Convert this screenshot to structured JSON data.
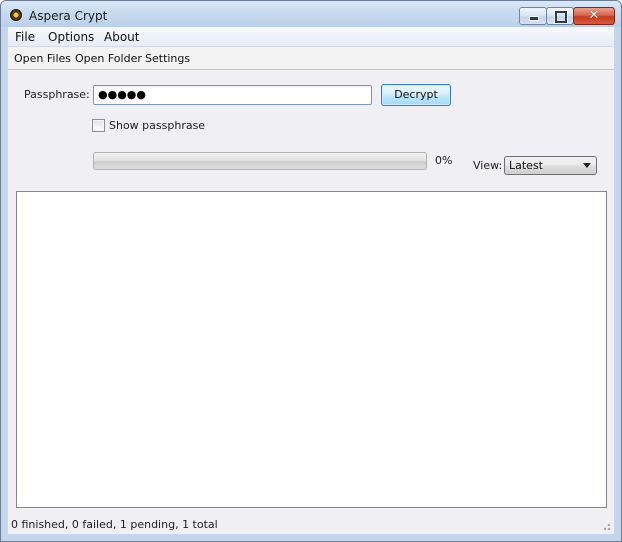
{
  "window": {
    "title": "Aspera Crypt",
    "app_icon": "aspera-crypt-icon",
    "controls": {
      "minimize_icon": "minimize-icon",
      "maximize_icon": "maximize-icon",
      "close_icon": "close-icon",
      "close_glyph": "✕"
    }
  },
  "menu": {
    "items": [
      "File",
      "Options",
      "About"
    ]
  },
  "toolbar": {
    "items": [
      "Open Files",
      "Open Folder",
      "Settings"
    ]
  },
  "form": {
    "passphrase_label": "Passphrase:",
    "passphrase_value": "●●●●●",
    "decrypt_label": "Decrypt",
    "show_passphrase_label": "Show passphrase",
    "show_passphrase_checked": false,
    "progress_value": 0,
    "progress_text": "0%",
    "view_label": "View:",
    "view_selected": "Latest"
  },
  "file_list": {
    "rows": []
  },
  "status": {
    "text": "0 finished, 0 failed, 1 pending, 1 total"
  },
  "colors": {
    "titlebar": "#c9dbf0",
    "client_background": "#f0eff3",
    "decrypt_button_border": "#3c7fb1",
    "close_button": "#c53a22"
  }
}
